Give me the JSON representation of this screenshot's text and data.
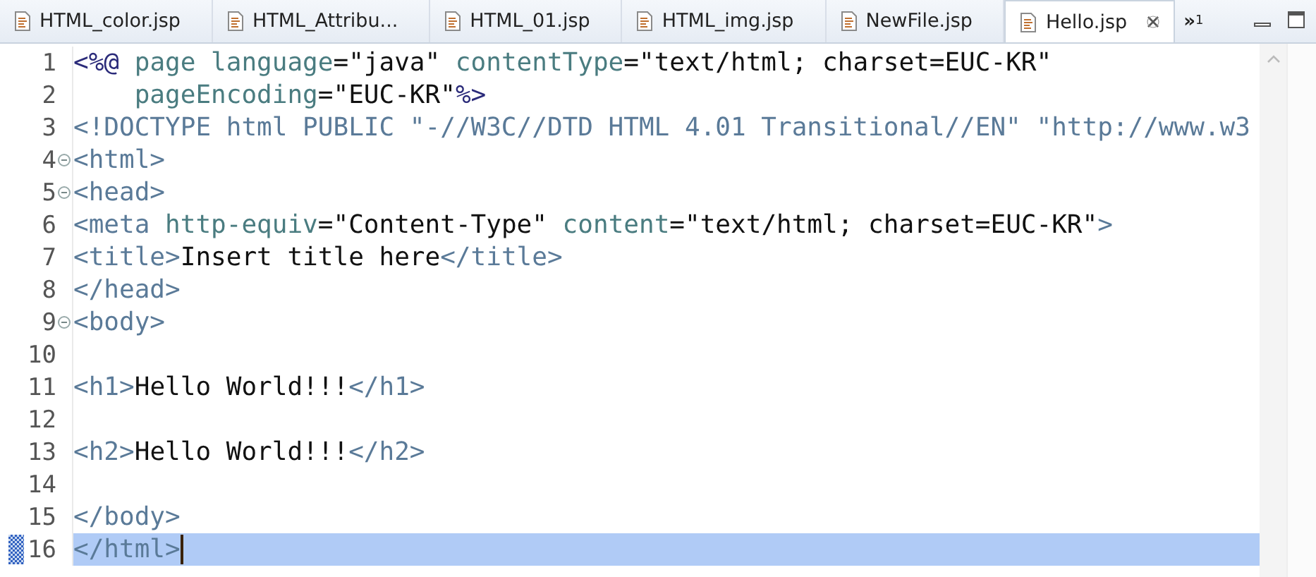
{
  "tabs": [
    {
      "label": "HTML_color.jsp",
      "selected": false
    },
    {
      "label": "HTML_Attribu...",
      "selected": false
    },
    {
      "label": "HTML_01.jsp",
      "selected": false
    },
    {
      "label": "HTML_img.jsp",
      "selected": false
    },
    {
      "label": "NewFile.jsp",
      "selected": false
    },
    {
      "label": "Hello.jsp",
      "selected": true
    }
  ],
  "overflow": {
    "glyph": "»",
    "count": "1"
  },
  "lines": [
    {
      "number": "1",
      "foldable": false,
      "current": false,
      "tokens": [
        {
          "kind": "jsp",
          "text": "<%@"
        },
        {
          "kind": "attr",
          "text": " page language"
        },
        {
          "kind": "text",
          "text": "=\"java\""
        },
        {
          "kind": "attr",
          "text": " contentType"
        },
        {
          "kind": "text",
          "text": "=\"text/html; charset=EUC-KR\""
        }
      ]
    },
    {
      "number": "2",
      "foldable": false,
      "current": false,
      "tokens": [
        {
          "kind": "attr",
          "text": "    pageEncoding"
        },
        {
          "kind": "text",
          "text": "=\"EUC-KR\""
        },
        {
          "kind": "jsp",
          "text": "%>"
        }
      ]
    },
    {
      "number": "3",
      "foldable": false,
      "current": false,
      "tokens": [
        {
          "kind": "tag",
          "text": "<!DOCTYPE html PUBLIC \"-//W3C//DTD HTML 4.01 Transitional//EN\" \"http://www.w3"
        }
      ]
    },
    {
      "number": "4",
      "foldable": true,
      "current": false,
      "tokens": [
        {
          "kind": "tag",
          "text": "<html>"
        }
      ]
    },
    {
      "number": "5",
      "foldable": true,
      "current": false,
      "tokens": [
        {
          "kind": "tag",
          "text": "<head>"
        }
      ]
    },
    {
      "number": "6",
      "foldable": false,
      "current": false,
      "tokens": [
        {
          "kind": "tag",
          "text": "<meta"
        },
        {
          "kind": "attr",
          "text": " http-equiv"
        },
        {
          "kind": "text",
          "text": "=\"Content-Type\""
        },
        {
          "kind": "attr",
          "text": " content"
        },
        {
          "kind": "text",
          "text": "=\"text/html; charset=EUC-KR\""
        },
        {
          "kind": "tag",
          "text": ">"
        }
      ]
    },
    {
      "number": "7",
      "foldable": false,
      "current": false,
      "tokens": [
        {
          "kind": "tag",
          "text": "<title>"
        },
        {
          "kind": "text",
          "text": "Insert title here"
        },
        {
          "kind": "tag",
          "text": "</title>"
        }
      ]
    },
    {
      "number": "8",
      "foldable": false,
      "current": false,
      "tokens": [
        {
          "kind": "tag",
          "text": "</head>"
        }
      ]
    },
    {
      "number": "9",
      "foldable": true,
      "current": false,
      "tokens": [
        {
          "kind": "tag",
          "text": "<body>"
        }
      ]
    },
    {
      "number": "10",
      "foldable": false,
      "current": false
    },
    {
      "number": "11",
      "foldable": false,
      "current": false,
      "tokens": [
        {
          "kind": "tag",
          "text": "<h1>"
        },
        {
          "kind": "text",
          "text": "Hello World!!!"
        },
        {
          "kind": "tag",
          "text": "</h1>"
        }
      ]
    },
    {
      "number": "12",
      "foldable": false,
      "current": false
    },
    {
      "number": "13",
      "foldable": false,
      "current": false,
      "tokens": [
        {
          "kind": "tag",
          "text": "<h2>"
        },
        {
          "kind": "text",
          "text": "Hello World!!!"
        },
        {
          "kind": "tag",
          "text": "</h2>"
        }
      ]
    },
    {
      "number": "14",
      "foldable": false,
      "current": false
    },
    {
      "number": "15",
      "foldable": false,
      "current": false,
      "tokens": [
        {
          "kind": "tag",
          "text": "</body>"
        }
      ]
    },
    {
      "number": "16",
      "foldable": false,
      "current": true,
      "tokens": [
        {
          "kind": "tag",
          "text": "</html>"
        }
      ]
    }
  ]
}
